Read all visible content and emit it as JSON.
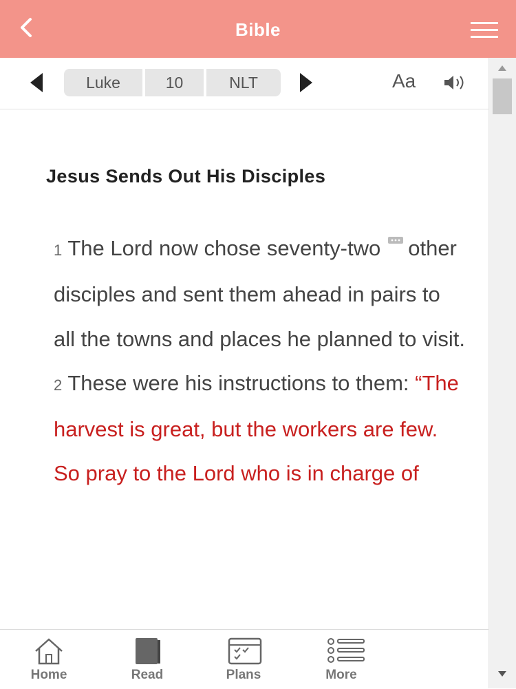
{
  "header": {
    "title": "Bible",
    "back_icon": "chevron-left-icon",
    "menu_icon": "hamburger-menu-icon",
    "color": "#f3948a"
  },
  "toolbar": {
    "book": "Luke",
    "chapter": "10",
    "version": "NLT",
    "font_label": "Aa"
  },
  "content": {
    "heading": "Jesus Sends Out His Disciples",
    "v1_num": "1",
    "v1_a": "The Lord now chose seventy-two",
    "v1_b": "other disciples and sent them ahead in pairs to all the towns and places he planned to visit.",
    "v2_num": "2",
    "v2_a": "These were his instructions to them:",
    "v2_red": "“The harvest is great, but the workers are few. So pray to the Lord who is in charge of",
    "red_color": "#c8201f"
  },
  "nav": {
    "home": "Home",
    "read": "Read",
    "plans": "Plans",
    "more": "More"
  }
}
